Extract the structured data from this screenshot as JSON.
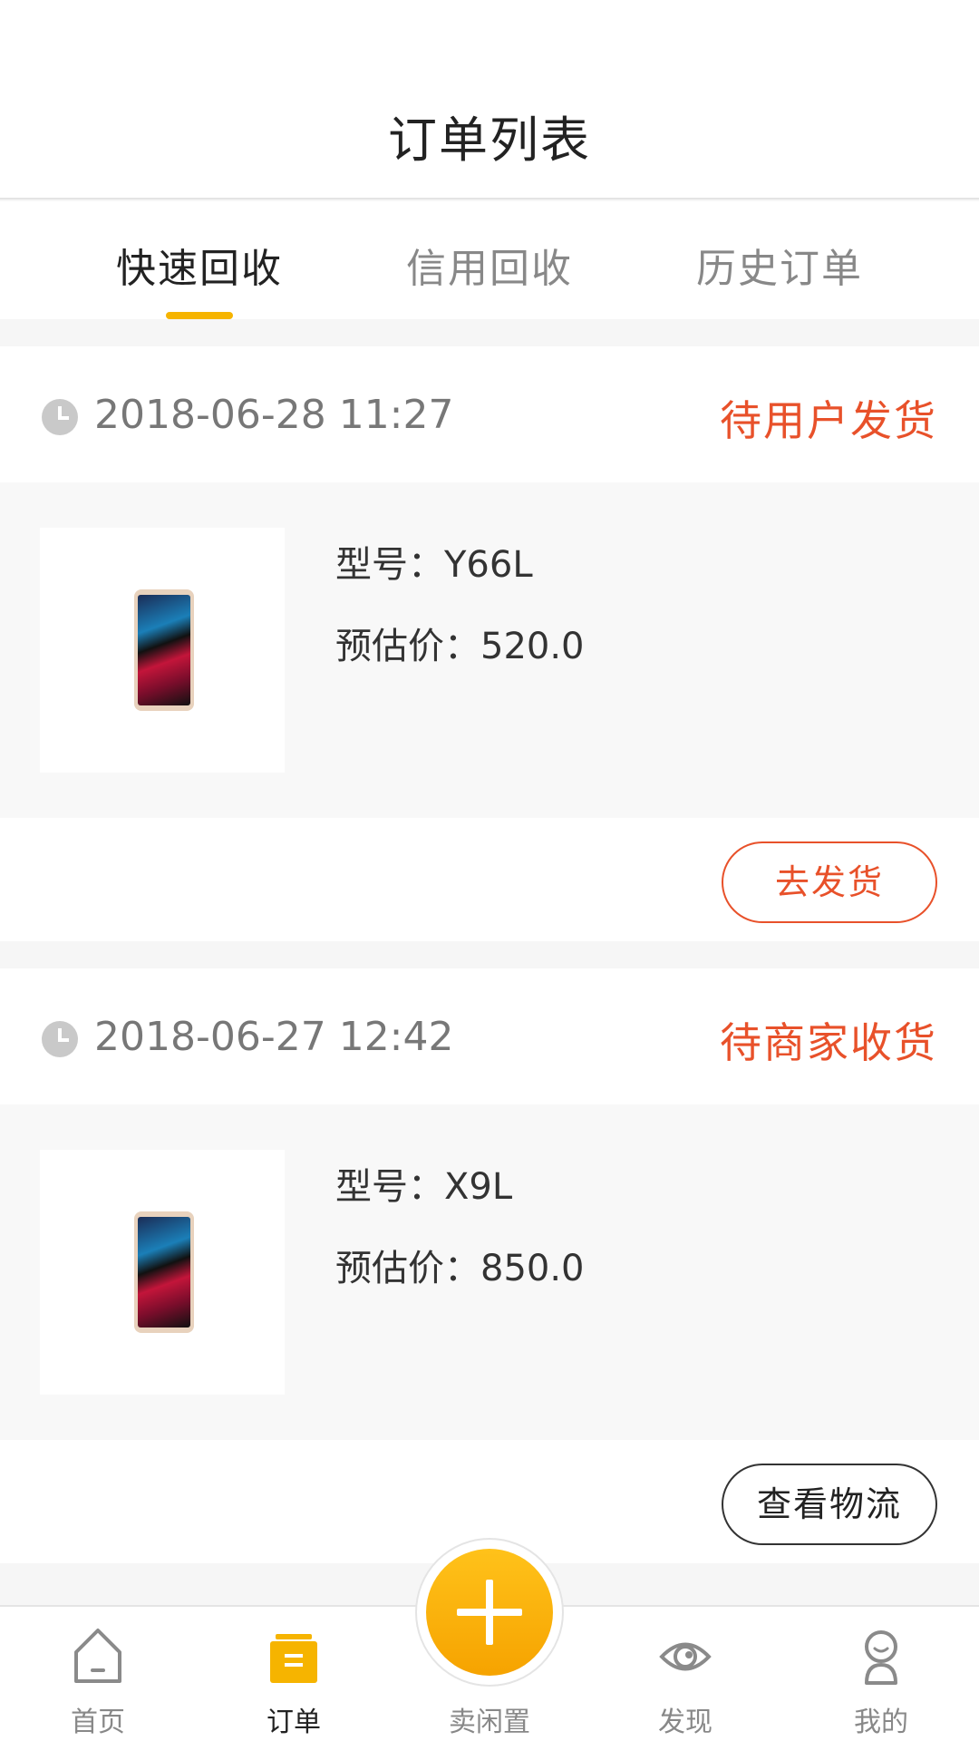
{
  "header": {
    "title": "订单列表"
  },
  "tabs": [
    {
      "label": "快速回收",
      "active": true
    },
    {
      "label": "信用回收",
      "active": false
    },
    {
      "label": "历史订单",
      "active": false
    }
  ],
  "colors": {
    "accent": "#f6b400",
    "status": "#e8512a"
  },
  "orders": [
    {
      "time": "2018-06-28 11:27",
      "status": "待用户发货",
      "model": "型号：Y66L",
      "price": "预估价：520.0",
      "action": "去发货"
    },
    {
      "time": "2018-06-27 12:42",
      "status": "待商家收货",
      "model": "型号：X9L",
      "price": "预估价：850.0",
      "action": "查看物流"
    }
  ],
  "bottom_nav": [
    {
      "label": "首页",
      "icon": "home-icon",
      "active": false
    },
    {
      "label": "订单",
      "icon": "orders-icon",
      "active": true
    },
    {
      "label": "卖闲置",
      "icon": "plus-icon",
      "active": false
    },
    {
      "label": "发现",
      "icon": "eye-icon",
      "active": false
    },
    {
      "label": "我的",
      "icon": "profile-icon",
      "active": false
    }
  ]
}
